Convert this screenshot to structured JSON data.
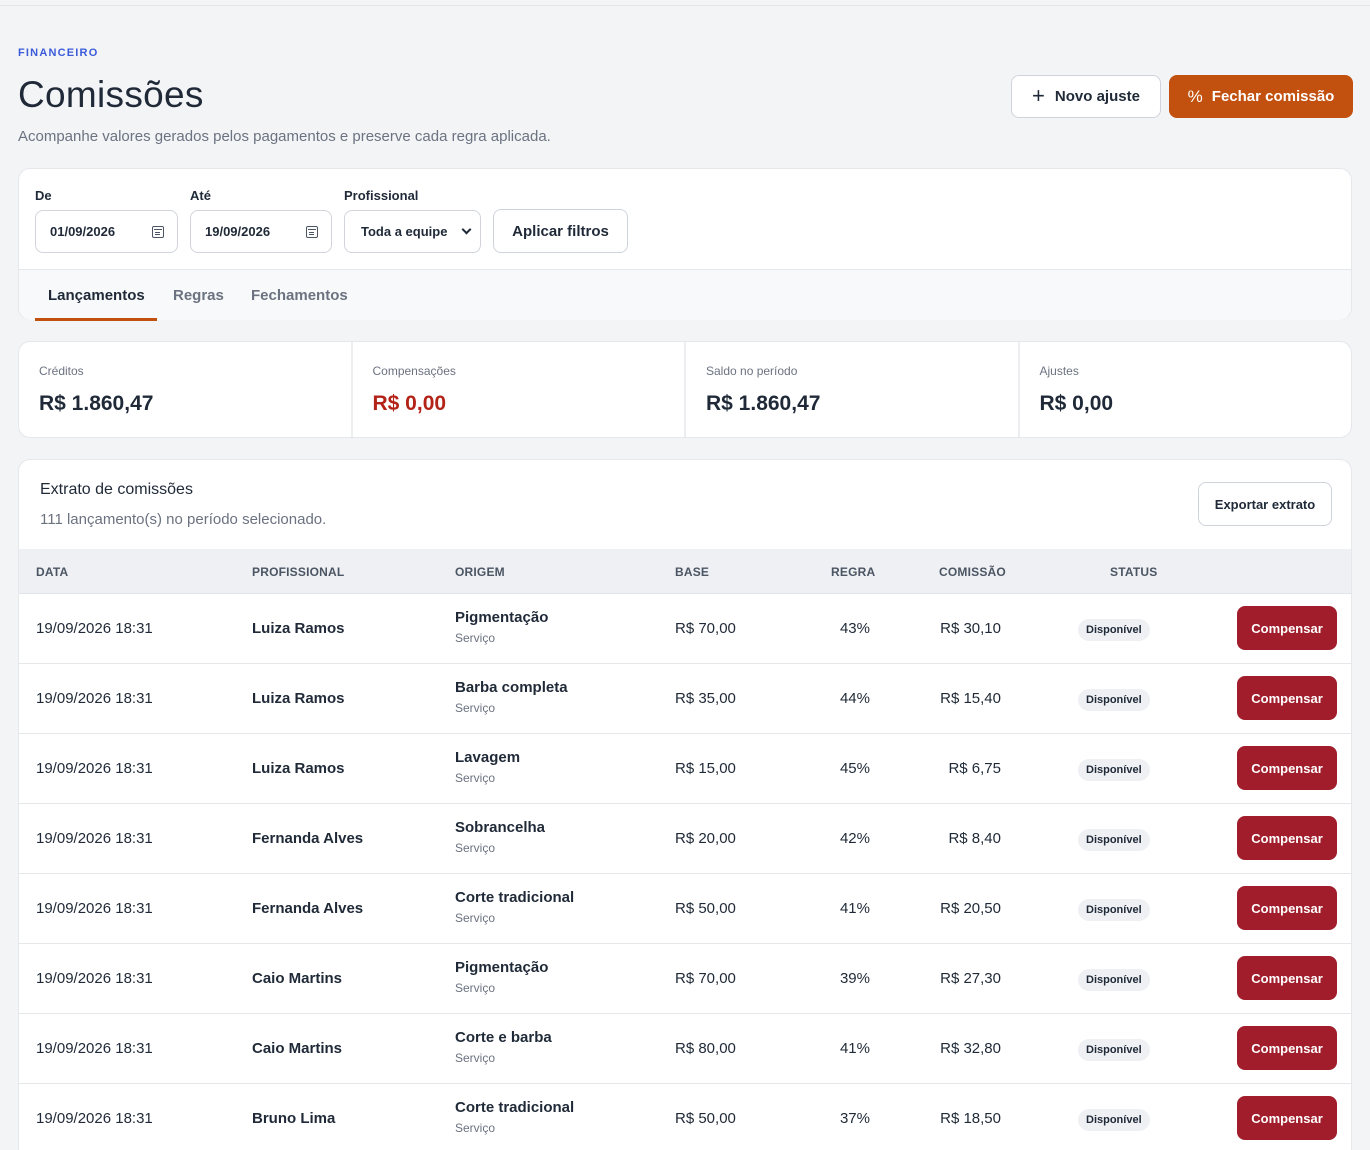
{
  "header": {
    "eyebrow": "FINANCEIRO",
    "title": "Comissões",
    "subtitle": "Acompanhe valores gerados pelos pagamentos e preserve cada regra aplicada.",
    "new_adjust_label": "Novo ajuste",
    "close_commission_label": "Fechar comissão",
    "plus_icon": "+",
    "percent_icon": "%"
  },
  "filters": {
    "from_label": "De",
    "from_value": "01/09/2026",
    "to_label": "Até",
    "to_value": "19/09/2026",
    "professional_label": "Profissional",
    "professional_value": "Toda a equipe",
    "apply_label": "Aplicar filtros"
  },
  "tabs": [
    {
      "label": "Lançamentos",
      "active": true
    },
    {
      "label": "Regras",
      "active": false
    },
    {
      "label": "Fechamentos",
      "active": false
    }
  ],
  "stats": [
    {
      "label": "Créditos",
      "value": "R$ 1.860,47"
    },
    {
      "label": "Compensações",
      "value": "R$ 0,00"
    },
    {
      "label": "Saldo no período",
      "value": "R$ 1.860,47"
    },
    {
      "label": "Ajustes",
      "value": "R$ 0,00"
    }
  ],
  "statement": {
    "title": "Extrato de comissões",
    "subtitle": "111 lançamento(s) no período selecionado.",
    "export_label": "Exportar extrato",
    "columns": [
      "DATA",
      "PROFISSIONAL",
      "ORIGEM",
      "BASE",
      "REGRA",
      "COMISSÃO",
      "STATUS"
    ],
    "rows": [
      {
        "date": "19/09/2026 18:31",
        "professional": "Luiza Ramos",
        "origin": "Pigmentação",
        "origin_type": "Serviço",
        "base": "R$ 70,00",
        "rule": "43%",
        "commission": "R$ 30,10",
        "status": "Disponível",
        "action": "Compensar"
      },
      {
        "date": "19/09/2026 18:31",
        "professional": "Luiza Ramos",
        "origin": "Barba completa",
        "origin_type": "Serviço",
        "base": "R$ 35,00",
        "rule": "44%",
        "commission": "R$ 15,40",
        "status": "Disponível",
        "action": "Compensar"
      },
      {
        "date": "19/09/2026 18:31",
        "professional": "Luiza Ramos",
        "origin": "Lavagem",
        "origin_type": "Serviço",
        "base": "R$ 15,00",
        "rule": "45%",
        "commission": "R$ 6,75",
        "status": "Disponível",
        "action": "Compensar"
      },
      {
        "date": "19/09/2026 18:31",
        "professional": "Fernanda Alves",
        "origin": "Sobrancelha",
        "origin_type": "Serviço",
        "base": "R$ 20,00",
        "rule": "42%",
        "commission": "R$ 8,40",
        "status": "Disponível",
        "action": "Compensar"
      },
      {
        "date": "19/09/2026 18:31",
        "professional": "Fernanda Alves",
        "origin": "Corte tradicional",
        "origin_type": "Serviço",
        "base": "R$ 50,00",
        "rule": "41%",
        "commission": "R$ 20,50",
        "status": "Disponível",
        "action": "Compensar"
      },
      {
        "date": "19/09/2026 18:31",
        "professional": "Caio Martins",
        "origin": "Pigmentação",
        "origin_type": "Serviço",
        "base": "R$ 70,00",
        "rule": "39%",
        "commission": "R$ 27,30",
        "status": "Disponível",
        "action": "Compensar"
      },
      {
        "date": "19/09/2026 18:31",
        "professional": "Caio Martins",
        "origin": "Corte e barba",
        "origin_type": "Serviço",
        "base": "R$ 80,00",
        "rule": "41%",
        "commission": "R$ 32,80",
        "status": "Disponível",
        "action": "Compensar"
      },
      {
        "date": "19/09/2026 18:31",
        "professional": "Bruno Lima",
        "origin": "Corte tradicional",
        "origin_type": "Serviço",
        "base": "R$ 50,00",
        "rule": "37%",
        "commission": "R$ 18,50",
        "status": "Disponível",
        "action": "Compensar"
      }
    ]
  },
  "colors": {
    "accent": "#c2510f",
    "danger_button": "#a11d2b",
    "negative_value": "#b42318",
    "eyebrow": "#3b5bdb"
  }
}
